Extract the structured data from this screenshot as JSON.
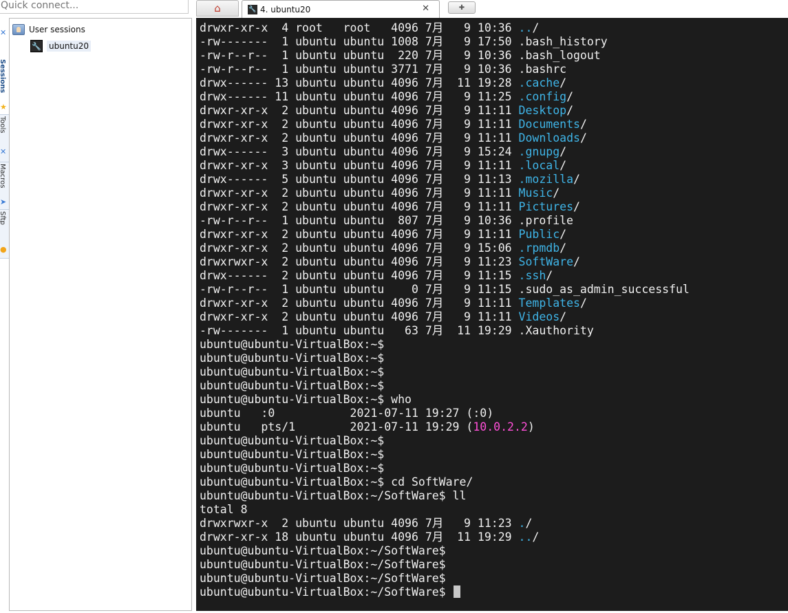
{
  "quick_connect": {
    "placeholder": "Quick connect..."
  },
  "side_tabs": {
    "sessions": "Sessions",
    "tools": "Tools",
    "macros": "Macros",
    "sftp": "Sftp"
  },
  "session_tree": {
    "root_label": "User sessions",
    "sessions": [
      {
        "label": "ubuntu20"
      }
    ]
  },
  "tabs": {
    "home_icon": "house-icon",
    "active": {
      "title": "4. ubuntu20",
      "close": "✕"
    },
    "new_tab_icon": "plus-icon"
  },
  "colors": {
    "terminal_bg": "#1c1c1c",
    "terminal_fg": "#f0f0f0",
    "dir": "#3fb5e8",
    "ip": "#ff4fd8"
  },
  "terminal": {
    "lines": [
      [
        {
          "t": "drwxr-xr-x  4 root   root   4096 7月   9 10:36 "
        },
        {
          "t": "..",
          "c": "dir"
        },
        {
          "t": "/"
        }
      ],
      [
        {
          "t": "-rw-------  1 ubuntu ubuntu 1008 7月   9 17:50 .bash_history"
        }
      ],
      [
        {
          "t": "-rw-r--r--  1 ubuntu ubuntu  220 7月   9 10:36 .bash_logout"
        }
      ],
      [
        {
          "t": "-rw-r--r--  1 ubuntu ubuntu 3771 7月   9 10:36 .bashrc"
        }
      ],
      [
        {
          "t": "drwx------ 13 ubuntu ubuntu 4096 7月  11 19:28 "
        },
        {
          "t": ".cache",
          "c": "dir"
        },
        {
          "t": "/"
        }
      ],
      [
        {
          "t": "drwx------ 11 ubuntu ubuntu 4096 7月   9 11:25 "
        },
        {
          "t": ".config",
          "c": "dir"
        },
        {
          "t": "/"
        }
      ],
      [
        {
          "t": "drwxr-xr-x  2 ubuntu ubuntu 4096 7月   9 11:11 "
        },
        {
          "t": "Desktop",
          "c": "dir"
        },
        {
          "t": "/"
        }
      ],
      [
        {
          "t": "drwxr-xr-x  2 ubuntu ubuntu 4096 7月   9 11:11 "
        },
        {
          "t": "Documents",
          "c": "dir"
        },
        {
          "t": "/"
        }
      ],
      [
        {
          "t": "drwxr-xr-x  2 ubuntu ubuntu 4096 7月   9 11:11 "
        },
        {
          "t": "Downloads",
          "c": "dir"
        },
        {
          "t": "/"
        }
      ],
      [
        {
          "t": "drwx------  3 ubuntu ubuntu 4096 7月   9 15:24 "
        },
        {
          "t": ".gnupg",
          "c": "dir"
        },
        {
          "t": "/"
        }
      ],
      [
        {
          "t": "drwxr-xr-x  3 ubuntu ubuntu 4096 7月   9 11:11 "
        },
        {
          "t": ".local",
          "c": "dir"
        },
        {
          "t": "/"
        }
      ],
      [
        {
          "t": "drwx------  5 ubuntu ubuntu 4096 7月   9 11:13 "
        },
        {
          "t": ".mozilla",
          "c": "dir"
        },
        {
          "t": "/"
        }
      ],
      [
        {
          "t": "drwxr-xr-x  2 ubuntu ubuntu 4096 7月   9 11:11 "
        },
        {
          "t": "Music",
          "c": "dir"
        },
        {
          "t": "/"
        }
      ],
      [
        {
          "t": "drwxr-xr-x  2 ubuntu ubuntu 4096 7月   9 11:11 "
        },
        {
          "t": "Pictures",
          "c": "dir"
        },
        {
          "t": "/"
        }
      ],
      [
        {
          "t": "-rw-r--r--  1 ubuntu ubuntu  807 7月   9 10:36 .profile"
        }
      ],
      [
        {
          "t": "drwxr-xr-x  2 ubuntu ubuntu 4096 7月   9 11:11 "
        },
        {
          "t": "Public",
          "c": "dir"
        },
        {
          "t": "/"
        }
      ],
      [
        {
          "t": "drwxr-xr-x  2 ubuntu ubuntu 4096 7月   9 15:06 "
        },
        {
          "t": ".rpmdb",
          "c": "dir"
        },
        {
          "t": "/"
        }
      ],
      [
        {
          "t": "drwxrwxr-x  2 ubuntu ubuntu 4096 7月   9 11:23 "
        },
        {
          "t": "SoftWare",
          "c": "dir"
        },
        {
          "t": "/"
        }
      ],
      [
        {
          "t": "drwx------  2 ubuntu ubuntu 4096 7月   9 11:15 "
        },
        {
          "t": ".ssh",
          "c": "dir"
        },
        {
          "t": "/"
        }
      ],
      [
        {
          "t": "-rw-r--r--  1 ubuntu ubuntu    0 7月   9 11:15 .sudo_as_admin_successful"
        }
      ],
      [
        {
          "t": "drwxr-xr-x  2 ubuntu ubuntu 4096 7月   9 11:11 "
        },
        {
          "t": "Templates",
          "c": "dir"
        },
        {
          "t": "/"
        }
      ],
      [
        {
          "t": "drwxr-xr-x  2 ubuntu ubuntu 4096 7月   9 11:11 "
        },
        {
          "t": "Videos",
          "c": "dir"
        },
        {
          "t": "/"
        }
      ],
      [
        {
          "t": "-rw-------  1 ubuntu ubuntu   63 7月  11 19:29 .Xauthority"
        }
      ],
      [
        {
          "t": "ubuntu@ubuntu-VirtualBox:~$"
        }
      ],
      [
        {
          "t": "ubuntu@ubuntu-VirtualBox:~$"
        }
      ],
      [
        {
          "t": "ubuntu@ubuntu-VirtualBox:~$"
        }
      ],
      [
        {
          "t": "ubuntu@ubuntu-VirtualBox:~$"
        }
      ],
      [
        {
          "t": "ubuntu@ubuntu-VirtualBox:~$ who"
        }
      ],
      [
        {
          "t": "ubuntu   :0           2021-07-11 19:27 (:0)"
        }
      ],
      [
        {
          "t": "ubuntu   pts/1        2021-07-11 19:29 ("
        },
        {
          "t": "10.0.2.2",
          "c": "ip"
        },
        {
          "t": ")"
        }
      ],
      [
        {
          "t": "ubuntu@ubuntu-VirtualBox:~$"
        }
      ],
      [
        {
          "t": "ubuntu@ubuntu-VirtualBox:~$"
        }
      ],
      [
        {
          "t": "ubuntu@ubuntu-VirtualBox:~$"
        }
      ],
      [
        {
          "t": "ubuntu@ubuntu-VirtualBox:~$ cd SoftWare/"
        }
      ],
      [
        {
          "t": "ubuntu@ubuntu-VirtualBox:~/SoftWare$ ll"
        }
      ],
      [
        {
          "t": "total 8"
        }
      ],
      [
        {
          "t": "drwxrwxr-x  2 ubuntu ubuntu 4096 7月   9 11:23 "
        },
        {
          "t": ".",
          "c": "dir"
        },
        {
          "t": "/"
        }
      ],
      [
        {
          "t": "drwxr-xr-x 18 ubuntu ubuntu 4096 7月  11 19:29 "
        },
        {
          "t": "..",
          "c": "dir"
        },
        {
          "t": "/"
        }
      ],
      [
        {
          "t": "ubuntu@ubuntu-VirtualBox:~/SoftWare$"
        }
      ],
      [
        {
          "t": "ubuntu@ubuntu-VirtualBox:~/SoftWare$"
        }
      ],
      [
        {
          "t": "ubuntu@ubuntu-VirtualBox:~/SoftWare$"
        }
      ],
      [
        {
          "t": "ubuntu@ubuntu-VirtualBox:~/SoftWare$ "
        }
      ]
    ]
  }
}
